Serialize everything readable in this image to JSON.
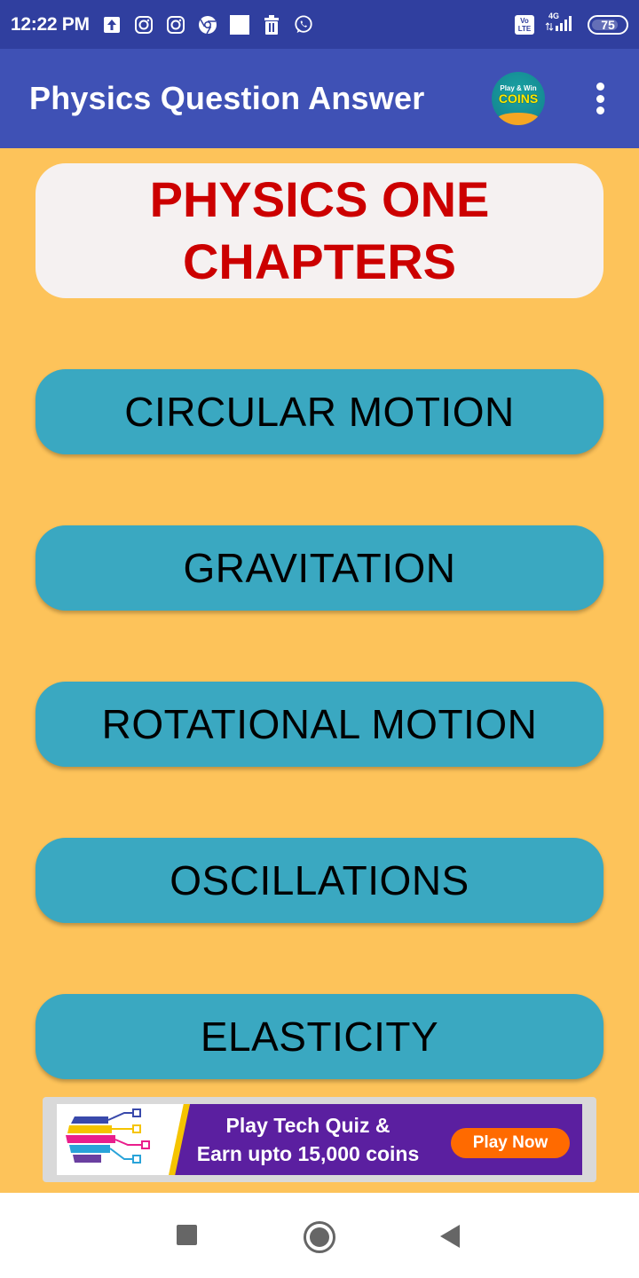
{
  "status_bar": {
    "time": "12:22 PM",
    "notification_icons": [
      "upload-icon",
      "instagram-icon",
      "instagram-icon",
      "chrome-icon",
      "blank-notification-icon",
      "trash-icon",
      "whatsapp-icon"
    ],
    "volte_label": "Vo LTE",
    "network_label": "4G",
    "battery_level": "75"
  },
  "app_bar": {
    "title": "Physics Question Answer",
    "coins_badge": {
      "small_text": "Play & Win",
      "big_text": "COINS"
    },
    "overflow_icon": "more-vert-icon"
  },
  "header": {
    "title": "PHYSICS ONE CHAPTERS",
    "color": "#cc0000"
  },
  "chapters": [
    {
      "label": "CIRCULAR MOTION"
    },
    {
      "label": "GRAVITATION"
    },
    {
      "label": "ROTATIONAL MOTION"
    },
    {
      "label": "OSCILLATIONS"
    },
    {
      "label": "ELASTICITY"
    }
  ],
  "ad": {
    "line1": "Play Tech Quiz &",
    "line2": "Earn upto 15,000 coins",
    "cta": "Play Now"
  },
  "colors": {
    "status_bar": "#303f9f",
    "app_bar": "#3f51b5",
    "background": "#fdc35a",
    "chapter_button": "#3aa8c1",
    "ad_cta": "#ff6a00"
  },
  "nav_bar": {
    "buttons": [
      "recents-icon",
      "home-icon",
      "back-icon"
    ]
  }
}
